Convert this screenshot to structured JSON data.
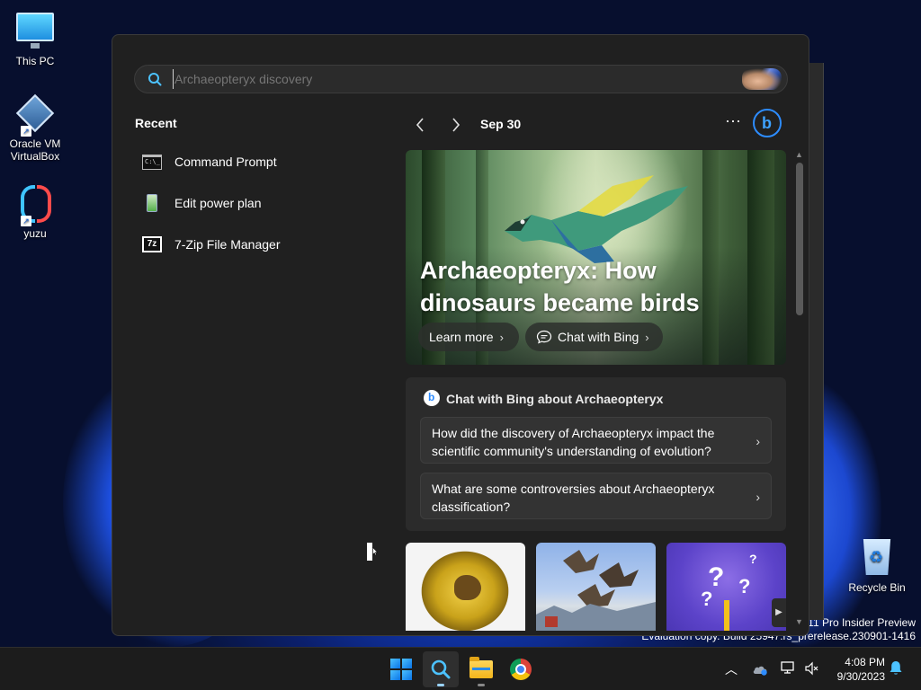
{
  "desktop": {
    "icons": [
      {
        "label": "This PC"
      },
      {
        "label": "Oracle VM VirtualBox"
      },
      {
        "label": "yuzu"
      },
      {
        "label": "Recycle Bin"
      }
    ],
    "watermark_line1": "s 11 Pro Insider Preview",
    "watermark_line2": "Evaluation copy. Build 25947.rs_prerelease.230901-1416"
  },
  "search": {
    "value": "",
    "placeholder": "Archaeopteryx discovery"
  },
  "recent": {
    "title": "Recent",
    "items": [
      {
        "label": "Command Prompt",
        "icon": "command-prompt-icon"
      },
      {
        "label": "Edit power plan",
        "icon": "power-plan-icon"
      },
      {
        "label": "7-Zip File Manager",
        "icon": "7zip-icon"
      }
    ]
  },
  "highlights": {
    "date": "Sep 30",
    "more_label": "···",
    "hero": {
      "title": "Archaeopteryx: How dinosaurs became birds",
      "learn_more": "Learn more",
      "chat_with_bing": "Chat with Bing"
    },
    "chat_card": {
      "title": "Chat with Bing about Archaeopteryx",
      "questions": [
        "How did the discovery of Archaeopteryx impact the scientific community's understanding of evolution?",
        "What are some controversies about Archaeopteryx classification?"
      ]
    },
    "thumb_icon_glyph": "7z"
  },
  "taskbar": {
    "time": "4:08 PM",
    "date": "9/30/2023"
  },
  "colors": {
    "accent": "#2d8cff",
    "panel_bg": "#202020",
    "card_bg": "#2b2b2b",
    "taskbar_bg": "#1c1c1c"
  }
}
